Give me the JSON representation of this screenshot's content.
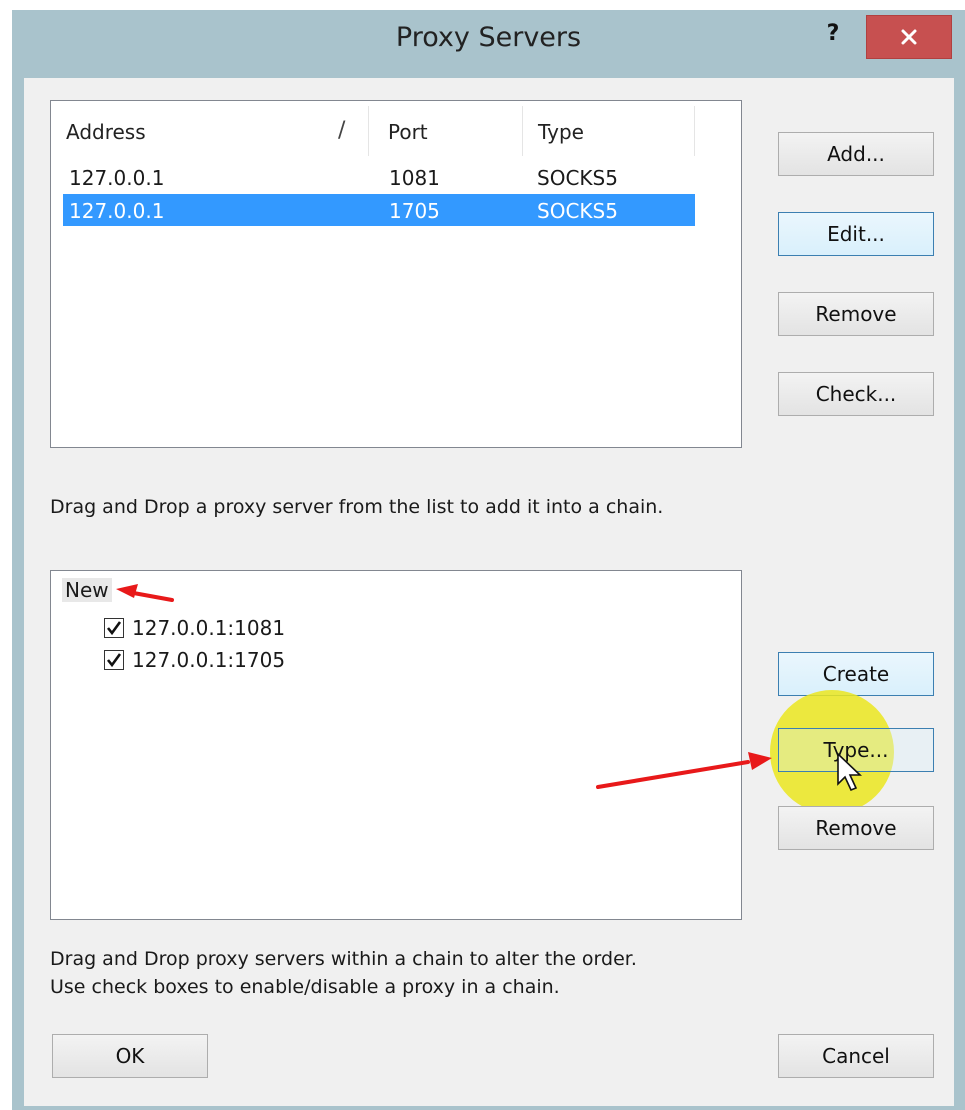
{
  "dialog": {
    "title": "Proxy Servers",
    "help_label": "?"
  },
  "server_list": {
    "columns": [
      "Address",
      "Port",
      "Type"
    ],
    "rows": [
      {
        "address": "127.0.0.1",
        "port": "1081",
        "type": "SOCKS5",
        "selected": false
      },
      {
        "address": "127.0.0.1",
        "port": "1705",
        "type": "SOCKS5",
        "selected": true
      }
    ]
  },
  "server_buttons": {
    "add": "Add...",
    "edit": "Edit...",
    "remove": "Remove",
    "check": "Check..."
  },
  "hint_top": "Drag and Drop a proxy server from the list to add it into a chain.",
  "chain_tree": {
    "root": "New",
    "items": [
      {
        "label": "127.0.0.1:1081",
        "checked": true
      },
      {
        "label": "127.0.0.1:1705",
        "checked": true
      }
    ]
  },
  "chain_buttons": {
    "create": "Create",
    "type": "Type...",
    "remove": "Remove"
  },
  "hint_bottom_1": "Drag and Drop proxy servers within a chain to alter the order.",
  "hint_bottom_2": "Use check boxes to enable/disable a proxy in a chain.",
  "footer": {
    "ok": "OK",
    "cancel": "Cancel"
  },
  "colors": {
    "selection": "#3399ff",
    "close_button": "#c75050",
    "annotation_arrow": "#e8191a",
    "cursor_highlight": "#ebe61e"
  }
}
